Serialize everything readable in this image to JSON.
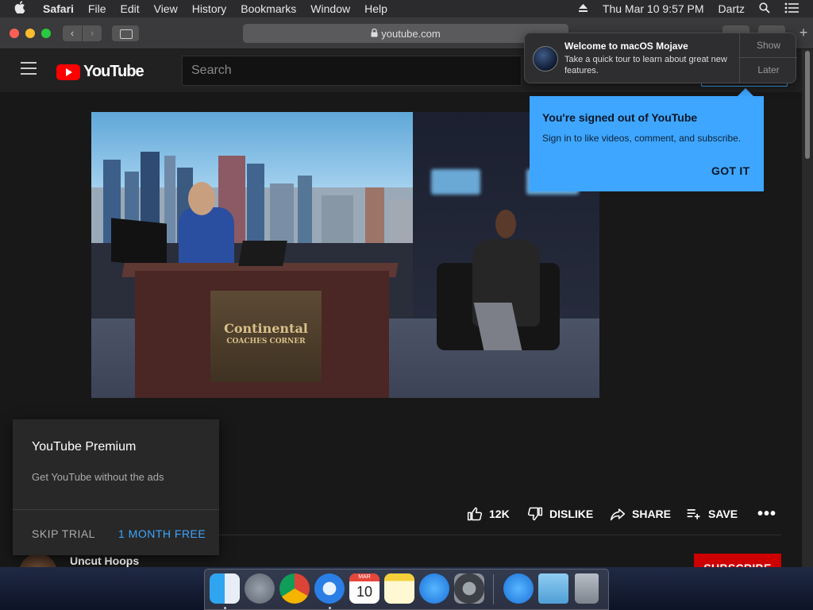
{
  "menubar": {
    "apple": "",
    "app": "Safari",
    "items": [
      "File",
      "Edit",
      "View",
      "History",
      "Bookmarks",
      "Window",
      "Help"
    ],
    "clock": "Thu Mar 10  9:57 PM",
    "user": "Dartz"
  },
  "safari": {
    "url": "youtube.com",
    "back": "‹",
    "forward": "›",
    "new_tab": "+"
  },
  "youtube": {
    "logo_text": "YouTube",
    "search_placeholder": "Search",
    "actions": {
      "likes": "12K",
      "dislike": "DISLIKE",
      "share": "SHARE",
      "save": "SAVE",
      "more": "•••"
    },
    "channel": {
      "name": "Uncut Hoops",
      "subscribe": "SUBSCRIBE"
    },
    "video_desk_brand": "Continental",
    "video_desk_sub": "COACHES CORNER"
  },
  "premium": {
    "title": "YouTube Premium",
    "subtitle": "Get YouTube without the ads",
    "skip": "SKIP TRIAL",
    "cta": "1 MONTH FREE"
  },
  "signed_out": {
    "title": "You're signed out of YouTube",
    "subtitle": "Sign in to like videos, comment, and subscribe.",
    "button": "GOT IT"
  },
  "notification": {
    "title": "Welcome to macOS Mojave",
    "body": "Take a quick tour to learn about great new features.",
    "show": "Show",
    "later": "Later"
  },
  "dock": {
    "calendar_month": "MAR",
    "calendar_day": "10",
    "icons": [
      "finder-icon",
      "launchpad-icon",
      "chrome-icon",
      "safari-icon",
      "calendar-icon",
      "notes-icon",
      "app-store-icon",
      "system-preferences-icon",
      "app-store-folder-icon",
      "downloads-folder-icon",
      "trash-icon"
    ]
  },
  "colors": {
    "youtube_red": "#ff0000",
    "subscribe_red": "#cc0000",
    "accent_blue": "#3ea6ff"
  }
}
